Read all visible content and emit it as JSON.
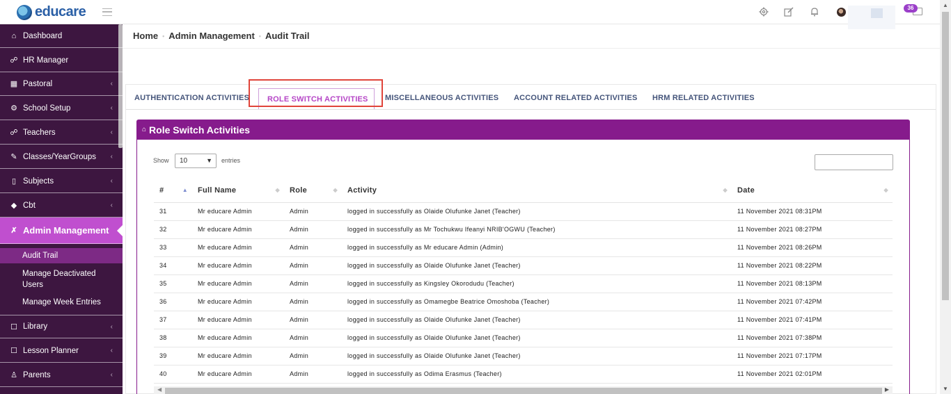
{
  "header": {
    "logo_text": "educare",
    "message_count": "36",
    "icons": [
      "settings-icon",
      "edit-icon",
      "bell-icon",
      "avatar",
      "envelope-icon"
    ]
  },
  "sidebar": {
    "items": [
      {
        "label": "Dashboard",
        "icon": "home-icon"
      },
      {
        "label": "HR Manager",
        "icon": "users-icon"
      },
      {
        "label": "Pastoral",
        "icon": "table-icon"
      },
      {
        "label": "School Setup",
        "icon": "gear-icon"
      },
      {
        "label": "Teachers",
        "icon": "users-icon"
      },
      {
        "label": "Classes/YearGroups",
        "icon": "edit-icon"
      },
      {
        "label": "Subjects",
        "icon": "book-icon"
      },
      {
        "label": "Cbt",
        "icon": "graduation-cap-icon"
      },
      {
        "label": "Admin Management",
        "icon": "wrench-icon"
      },
      {
        "label": "Library",
        "icon": "square-icon"
      },
      {
        "label": "Lesson Planner",
        "icon": "square-icon"
      },
      {
        "label": "Parents",
        "icon": "user-icon"
      }
    ],
    "sub_items": [
      "Audit Trail",
      "Manage Deactivated Users",
      "Manage Week Entries"
    ]
  },
  "breadcrumb": [
    "Home",
    "Admin Management",
    "Audit Trail"
  ],
  "tabs": [
    "AUTHENTICATION ACTIVITIES",
    "ROLE SWITCH ACTIVITIES",
    "MISCELLANEOUS ACTIVITIES",
    "ACCOUNT RELATED ACTIVITIES",
    "HRM RELATED ACTIVITIES"
  ],
  "active_tab": "ROLE SWITCH ACTIVITIES",
  "card": {
    "title": "Role Switch Activities",
    "show_label": "Show",
    "entries_value": "10",
    "entries_label": "entries"
  },
  "table": {
    "columns": [
      "#",
      "Full Name",
      "Role",
      "Activity",
      "Date"
    ],
    "rows": [
      [
        "31",
        "Mr educare Admin",
        "Admin",
        "logged in successfully as Olaide Olufunke Janet (Teacher)",
        "11 November 2021 08:31PM"
      ],
      [
        "32",
        "Mr educare Admin",
        "Admin",
        "logged in successfully as Mr Tochukwu Ifeanyi NRIB'OGWU (Teacher)",
        "11 November 2021 08:27PM"
      ],
      [
        "33",
        "Mr educare Admin",
        "Admin",
        "logged in successfully as Mr educare Admin (Admin)",
        "11 November 2021 08:26PM"
      ],
      [
        "34",
        "Mr educare Admin",
        "Admin",
        "logged in successfully as Olaide Olufunke Janet (Teacher)",
        "11 November 2021 08:22PM"
      ],
      [
        "35",
        "Mr educare Admin",
        "Admin",
        "logged in successfully as Kingsley Okorodudu (Teacher)",
        "11 November 2021 08:13PM"
      ],
      [
        "36",
        "Mr educare Admin",
        "Admin",
        "logged in successfully as Omamegbe Beatrice Omoshoba (Teacher)",
        "11 November 2021 07:42PM"
      ],
      [
        "37",
        "Mr educare Admin",
        "Admin",
        "logged in successfully as Olaide Olufunke Janet (Teacher)",
        "11 November 2021 07:41PM"
      ],
      [
        "38",
        "Mr educare Admin",
        "Admin",
        "logged in successfully as Olaide Olufunke Janet (Teacher)",
        "11 November 2021 07:38PM"
      ],
      [
        "39",
        "Mr educare Admin",
        "Admin",
        "logged in successfully as Olaide Olufunke Janet (Teacher)",
        "11 November 2021 07:17PM"
      ],
      [
        "40",
        "Mr educare Admin",
        "Admin",
        "logged in successfully as Odima Erasmus (Teacher)",
        "11 November 2021 02:01PM"
      ]
    ]
  },
  "colors": {
    "sidebar_bg": "#3d1640",
    "sidebar_active": "#c04fcf",
    "card_header": "#861b8c",
    "active_tab": "#b545c6",
    "tab_text": "#44547a",
    "highlight": "#e0443a"
  }
}
